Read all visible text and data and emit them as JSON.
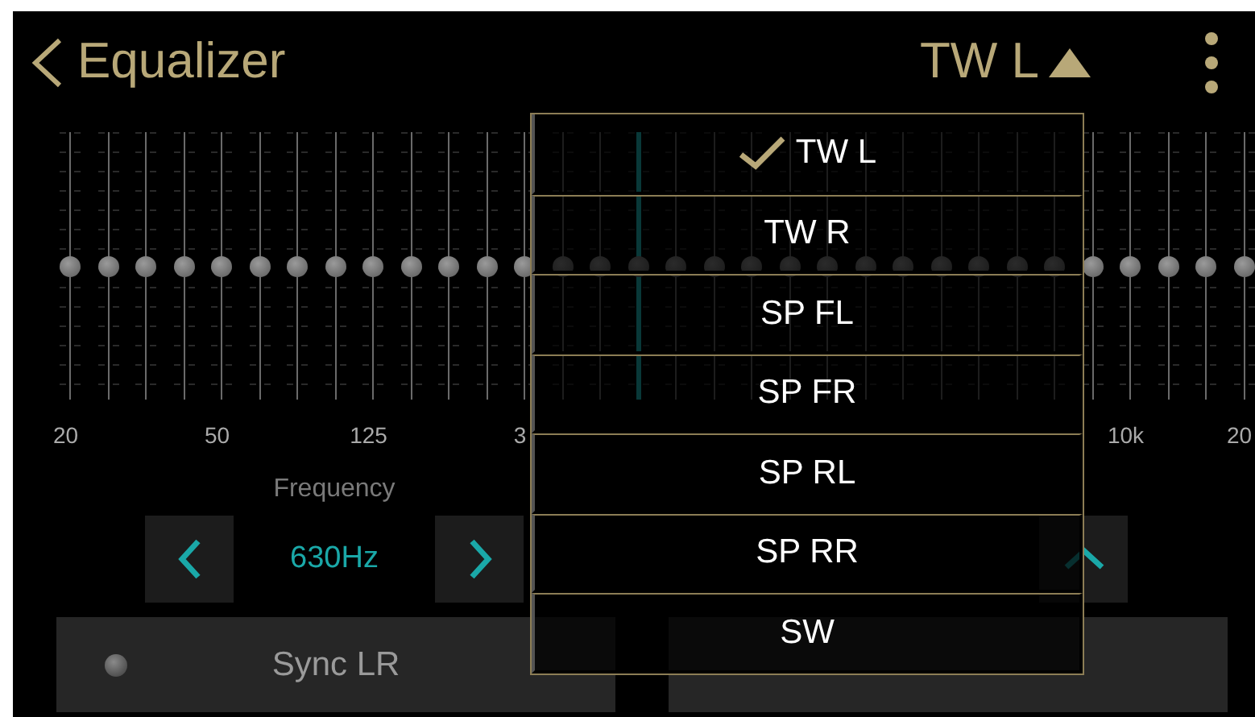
{
  "header": {
    "title": "Equalizer",
    "channel": "TW L",
    "menu_open": true
  },
  "bands": [
    {
      "level": 0.5,
      "selected": false,
      "label": "20"
    },
    {
      "level": 0.5,
      "selected": false
    },
    {
      "level": 0.5,
      "selected": false
    },
    {
      "level": 0.5,
      "selected": false
    },
    {
      "level": 0.5,
      "selected": false,
      "label": "50"
    },
    {
      "level": 0.5,
      "selected": false
    },
    {
      "level": 0.5,
      "selected": false
    },
    {
      "level": 0.5,
      "selected": false
    },
    {
      "level": 0.5,
      "selected": false,
      "label": "125"
    },
    {
      "level": 0.5,
      "selected": false
    },
    {
      "level": 0.5,
      "selected": false
    },
    {
      "level": 0.5,
      "selected": false
    },
    {
      "level": 0.5,
      "selected": false,
      "label": "3"
    },
    {
      "level": 0.5,
      "selected": false
    },
    {
      "level": 0.5,
      "selected": false
    },
    {
      "level": 0.5,
      "selected": true
    },
    {
      "level": 0.5,
      "selected": false
    },
    {
      "level": 0.5,
      "selected": false
    },
    {
      "level": 0.5,
      "selected": false
    },
    {
      "level": 0.5,
      "selected": false
    },
    {
      "level": 0.5,
      "selected": false
    },
    {
      "level": 0.5,
      "selected": false
    },
    {
      "level": 0.5,
      "selected": false
    },
    {
      "level": 0.5,
      "selected": false
    },
    {
      "level": 0.5,
      "selected": false
    },
    {
      "level": 0.5,
      "selected": false
    },
    {
      "level": 0.5,
      "selected": false
    },
    {
      "level": 0.5,
      "selected": false
    },
    {
      "level": 0.5,
      "selected": false,
      "label": "10k"
    },
    {
      "level": 0.5,
      "selected": false
    },
    {
      "level": 0.5,
      "selected": false
    },
    {
      "level": 0.5,
      "selected": false,
      "label": "20"
    }
  ],
  "frequency": {
    "label": "Frequency",
    "value": "630Hz"
  },
  "sync": {
    "label": "Sync LR",
    "on": false
  },
  "channel_menu": [
    {
      "label": "TW L",
      "selected": true
    },
    {
      "label": "TW R",
      "selected": false
    },
    {
      "label": "SP FL",
      "selected": false
    },
    {
      "label": "SP FR",
      "selected": false
    },
    {
      "label": "SP RL",
      "selected": false
    },
    {
      "label": "SP RR",
      "selected": false
    },
    {
      "label": "SW",
      "selected": false
    }
  ]
}
